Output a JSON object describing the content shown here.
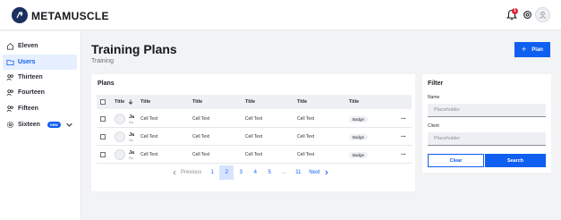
{
  "app": {
    "brand": "METAMUSCLE",
    "notification_count": "1"
  },
  "sidebar": {
    "items": [
      {
        "label": "Eleven",
        "icon": "home-icon"
      },
      {
        "label": "Users",
        "icon": "folder-icon",
        "active": true
      },
      {
        "label": "Thirteen",
        "icon": "users-icon"
      },
      {
        "label": "Fourteen",
        "icon": "users-icon"
      },
      {
        "label": "Fifteen",
        "icon": "users-icon"
      },
      {
        "label": "Sixteen",
        "icon": "gear-icon",
        "badge": "new"
      }
    ]
  },
  "header": {
    "title": "Training Plans",
    "subtitle": "Training",
    "plan_button": "Plan"
  },
  "plans": {
    "title": "Plans",
    "columns": [
      "Title",
      "Title",
      "Title",
      "Title",
      "Title",
      "Title"
    ],
    "rows": [
      {
        "name": "Ja",
        "sub": "Su",
        "cells": [
          "Cell Text",
          "Cell Text",
          "Cell Text",
          "Cell Text"
        ],
        "badge": "Badge"
      },
      {
        "name": "Ja",
        "sub": "Su",
        "cells": [
          "Cell Text",
          "Cell Text",
          "Cell Text",
          "Cell Text"
        ],
        "badge": "Badge"
      },
      {
        "name": "Ja",
        "sub": "Su",
        "cells": [
          "Cell Text",
          "Cell Text",
          "Cell Text",
          "Cell Text"
        ],
        "badge": "Badge"
      }
    ],
    "pagination": {
      "previous": "Previous",
      "next": "Next",
      "pages": [
        "1",
        "2",
        "3",
        "4",
        "5",
        "...",
        "11"
      ],
      "current": "2"
    }
  },
  "filter": {
    "title": "Filter",
    "name_label": "Name",
    "name_placeholder": "Placeholder",
    "client_label": "Client",
    "client_placeholder": "Placeholder",
    "clear_label": "Clear",
    "search_label": "Search"
  },
  "colors": {
    "accent": "#0f5ff0",
    "notification": "#e0243a",
    "brand_dark": "#1a3060"
  }
}
